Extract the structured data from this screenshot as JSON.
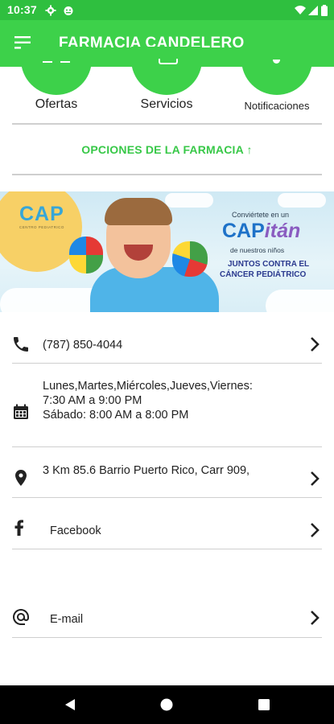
{
  "status_bar": {
    "time": "10:37"
  },
  "app_bar": {
    "title": "FARMACIA CANDELERO"
  },
  "shortcuts": [
    {
      "label": "Ofertas"
    },
    {
      "label": "Servicios"
    },
    {
      "label": "Notificaciones"
    }
  ],
  "options_link": "OPCIONES DE LA FARMACIA ↑",
  "banner": {
    "logo": "CAP",
    "logo_sub": "CENTRO PEDIATRICO",
    "line1": "Conviértete en un",
    "brand_a": "CAP",
    "brand_b": "itán",
    "line2": "de nuestros niños",
    "line3": "JUNTOS CONTRA EL",
    "line4": "CÁNCER PEDIÁTRICO"
  },
  "info": {
    "phone": "(787) 850-4044",
    "hours": [
      "Lunes,Martes,Miércoles,Jueves,Viernes:",
      "7:30 AM a 9:00 PM",
      "Sábado: 8:00 AM a 8:00 PM"
    ],
    "address": "3 Km 85.6 Barrio Puerto Rico, Carr 909,",
    "facebook": "Facebook",
    "email": "E-mail"
  },
  "colors": {
    "primary": "#3dd14a",
    "status": "#2fbf3f",
    "link": "#38c848"
  }
}
